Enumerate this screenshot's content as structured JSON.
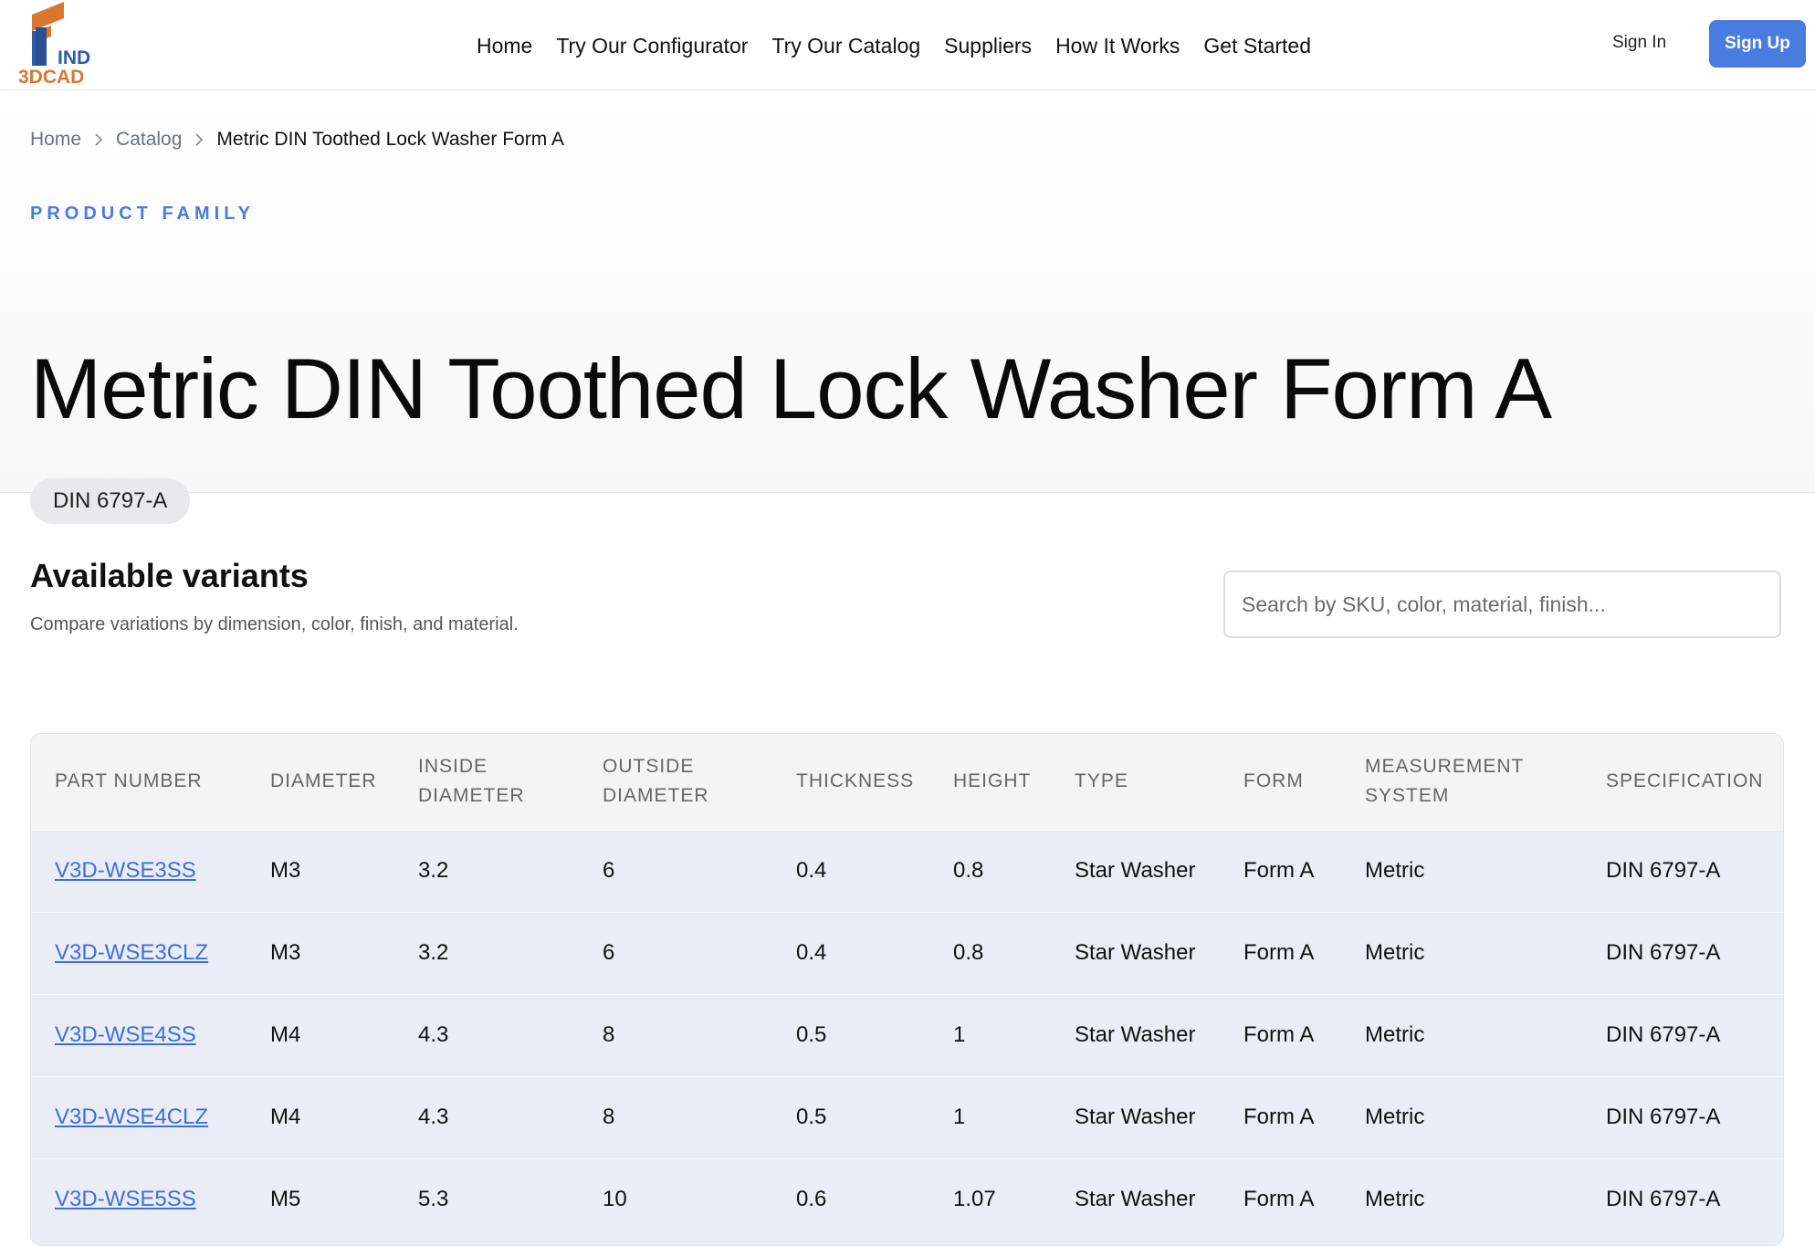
{
  "brand": {
    "logo_text_top": "IND",
    "logo_text_bottom": "3DCAD"
  },
  "nav": {
    "items": [
      "Home",
      "Try Our Configurator",
      "Try Our Catalog",
      "Suppliers",
      "How It Works",
      "Get Started"
    ],
    "sign_in": "Sign In",
    "sign_up": "Sign Up"
  },
  "breadcrumb": {
    "home": "Home",
    "catalog": "Catalog",
    "current": "Metric DIN Toothed Lock Washer Form A"
  },
  "hero": {
    "eyebrow": "PRODUCT FAMILY",
    "title": "Metric DIN Toothed Lock Washer Form A",
    "badge": "DIN 6797-A"
  },
  "variants": {
    "title": "Available variants",
    "subtitle": "Compare variations by dimension, color, finish, and material.",
    "search_placeholder": "Search by SKU, color, material, finish...",
    "columns": [
      "PART NUMBER",
      "DIAMETER",
      "INSIDE DIAMETER",
      "OUTSIDE DIAMETER",
      "THICKNESS",
      "HEIGHT",
      "TYPE",
      "FORM",
      "MEASUREMENT SYSTEM",
      "SPECIFICATION"
    ],
    "rows": [
      [
        "V3D-WSE3SS",
        "M3",
        "3.2",
        "6",
        "0.4",
        "0.8",
        "Star Washer",
        "Form A",
        "Metric",
        "DIN 6797-A"
      ],
      [
        "V3D-WSE3CLZ",
        "M3",
        "3.2",
        "6",
        "0.4",
        "0.8",
        "Star Washer",
        "Form A",
        "Metric",
        "DIN 6797-A"
      ],
      [
        "V3D-WSE4SS",
        "M4",
        "4.3",
        "8",
        "0.5",
        "1",
        "Star Washer",
        "Form A",
        "Metric",
        "DIN 6797-A"
      ],
      [
        "V3D-WSE4CLZ",
        "M4",
        "4.3",
        "8",
        "0.5",
        "1",
        "Star Washer",
        "Form A",
        "Metric",
        "DIN 6797-A"
      ],
      [
        "V3D-WSE5SS",
        "M5",
        "5.3",
        "10",
        "0.6",
        "1.07",
        "Star Washer",
        "Form A",
        "Metric",
        "DIN 6797-A"
      ]
    ]
  },
  "colors": {
    "accent": "#4a7bdf",
    "link": "#3f6fd8",
    "logo_orange": "#d9772f",
    "logo_blue": "#2f5aa8"
  }
}
